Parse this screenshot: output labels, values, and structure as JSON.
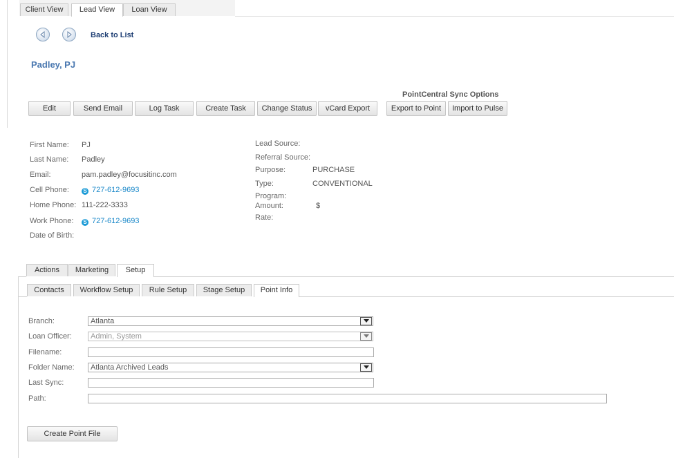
{
  "view_tabs": [
    "Client View",
    "Lead View",
    "Loan View"
  ],
  "nav": {
    "back_label": "Back to List"
  },
  "lead": {
    "name": "Padley, PJ"
  },
  "actions": {
    "buttons": [
      "Edit",
      "Send Email",
      "Log Task",
      "Create Task",
      "Change Status",
      "vCard Export"
    ],
    "sync_title": "PointCentral Sync Options",
    "sync_buttons": [
      "Export to Point",
      "Import to Pulse"
    ]
  },
  "contact": {
    "first_name_label": "First Name:",
    "first_name": "PJ",
    "last_name_label": "Last Name:",
    "last_name": "Padley",
    "email_label": "Email:",
    "email": "pam.padley@focusitinc.com",
    "cell_label": "Cell Phone:",
    "cell": "727-612-9693",
    "home_label": "Home Phone:",
    "home": "111-222-3333",
    "work_label": "Work Phone:",
    "work": "727-612-9693",
    "dob_label": "Date of Birth:",
    "dob": ""
  },
  "loan": {
    "lead_source_label": "Lead Source:",
    "lead_source": "",
    "referral_label": "Referral Source:",
    "referral": "",
    "purpose_label": "Purpose:",
    "purpose": "PURCHASE",
    "type_label": "Type:",
    "type": "CONVENTIONAL",
    "program_label": "Program:",
    "program": "",
    "amount_label": "Amount:",
    "amount": "$",
    "rate_label": "Rate:",
    "rate": ""
  },
  "section_tabs": [
    "Actions",
    "Marketing",
    "Setup"
  ],
  "sub_tabs": [
    "Contacts",
    "Workflow Setup",
    "Rule Setup",
    "Stage Setup",
    "Point Info"
  ],
  "point_info": {
    "branch_label": "Branch:",
    "branch": "Atlanta",
    "loan_officer_label": "Loan Officer:",
    "loan_officer": "Admin, System",
    "filename_label": "Filename:",
    "filename": "",
    "folder_label": "Folder Name:",
    "folder": "Atlanta Archived Leads",
    "last_sync_label": "Last Sync:",
    "last_sync": "",
    "path_label": "Path:",
    "path": "",
    "create_button": "Create Point File"
  },
  "colors": {
    "accent": "#4a78b0",
    "link": "#1f3f74",
    "phone": "#1a88c9"
  },
  "icons": {
    "back": "arrow-left-circle-icon",
    "forward": "arrow-right-circle-icon",
    "skype": "skype-icon",
    "dropdown": "chevron-down-icon"
  }
}
